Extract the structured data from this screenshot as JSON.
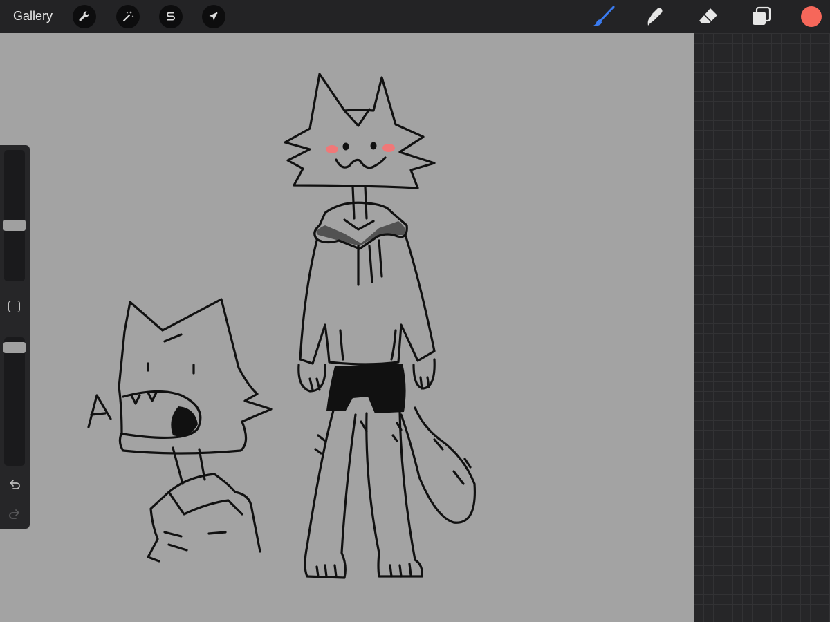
{
  "app": {
    "gallery_label": "Gallery"
  },
  "toolbar": {
    "left_tools": [
      {
        "name": "actions",
        "icon": "wrench-icon"
      },
      {
        "name": "adjustments",
        "icon": "magic-wand-icon"
      },
      {
        "name": "selection",
        "icon": "selection-s-icon"
      },
      {
        "name": "transform",
        "icon": "arrow-cursor-icon"
      }
    ],
    "right_tools": [
      {
        "name": "brush",
        "icon": "brush-icon",
        "active": true
      },
      {
        "name": "smudge",
        "icon": "smudge-icon",
        "active": false
      },
      {
        "name": "eraser",
        "icon": "eraser-icon",
        "active": false
      },
      {
        "name": "layers",
        "icon": "layers-icon",
        "active": false
      }
    ],
    "current_color": "#f6675a",
    "active_tool_color": "#3a7bf0"
  },
  "sidebar": {
    "brush_size_level": 0.42,
    "opacity_level": 0.96,
    "undo_icon": "undo-icon",
    "redo_icon": "redo-icon"
  },
  "canvas": {
    "background_color": "#a3a3a3",
    "ink_color": "#111111",
    "blush_color": "#f07878",
    "sketch_text": "A"
  }
}
